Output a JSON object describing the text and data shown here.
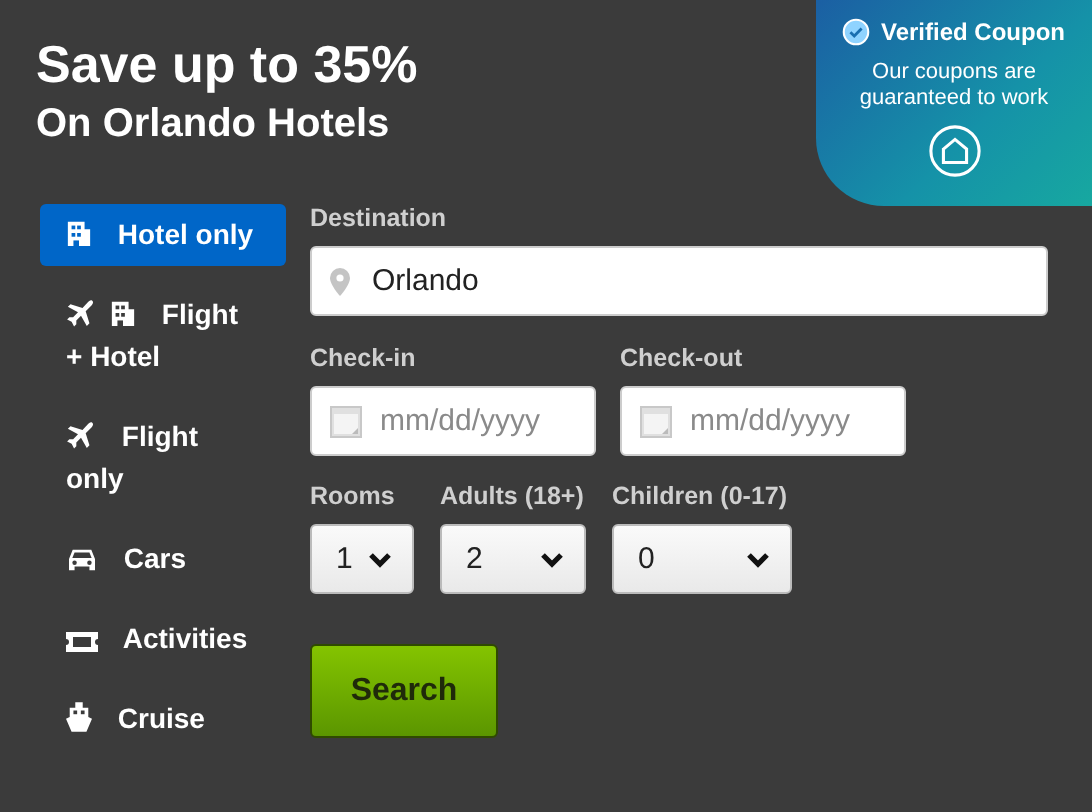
{
  "promo": {
    "headline": "Save up to 35%",
    "subheadline": "On Orlando Hotels"
  },
  "coupon": {
    "title": "Verified Coupon",
    "text": "Our coupons are guaranteed to work"
  },
  "nav": [
    {
      "label": "Hotel only",
      "kind": "hotel",
      "selected": true
    },
    {
      "label": "Flight + Hotel",
      "kind": "package",
      "selected": false
    },
    {
      "label": "Flight only",
      "kind": "flight",
      "selected": false
    },
    {
      "label": "Cars",
      "kind": "car",
      "selected": false
    },
    {
      "label": "Activities",
      "kind": "activity",
      "selected": false
    },
    {
      "label": "Cruise",
      "kind": "cruise",
      "selected": false
    }
  ],
  "form": {
    "destination": {
      "label": "Destination",
      "value": "Orlando"
    },
    "check_in": {
      "label": "Check-in",
      "placeholder": "mm/dd/yyyy"
    },
    "check_out": {
      "label": "Check-out",
      "placeholder": "mm/dd/yyyy"
    },
    "selects": [
      {
        "label": "Rooms",
        "value": "1"
      },
      {
        "label": "Adults (18+)",
        "value": "2"
      },
      {
        "label": "Children (0-17)",
        "value": "0"
      }
    ],
    "search_button": "Search"
  }
}
